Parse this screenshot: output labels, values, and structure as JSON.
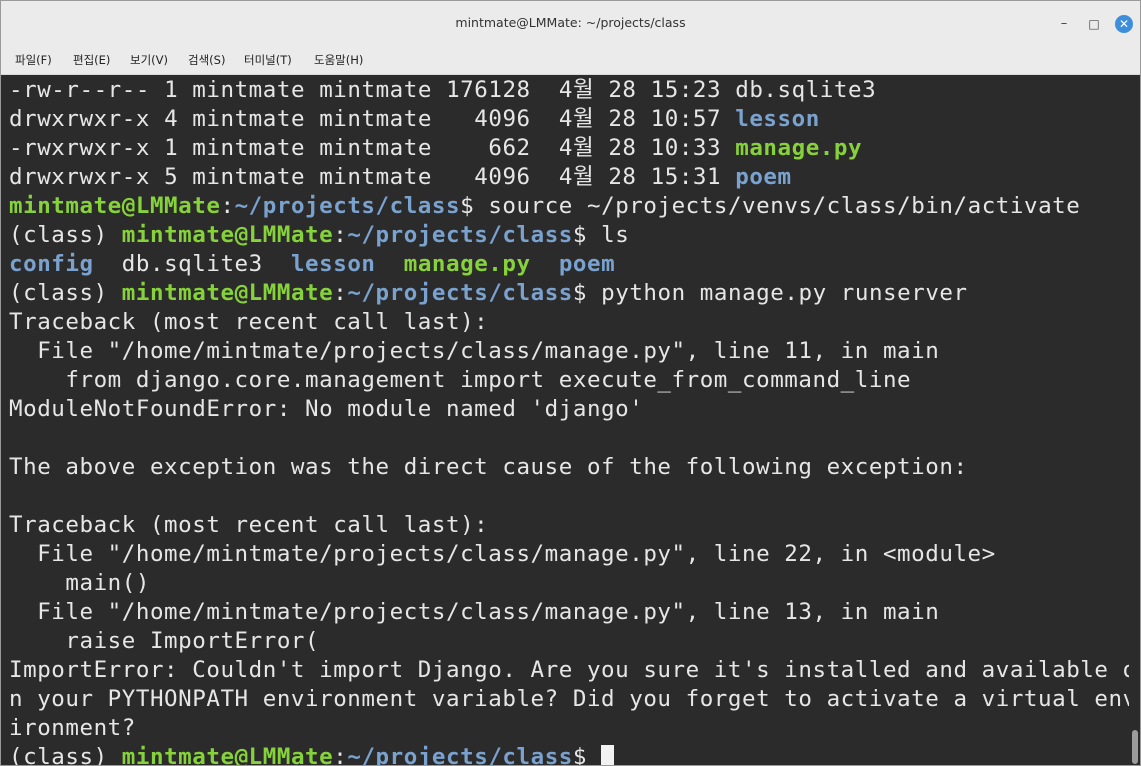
{
  "window": {
    "title": "mintmate@LMMate: ~/projects/class"
  },
  "menu": {
    "items": [
      "파일(F)",
      "편집(E)",
      "보기(V)",
      "검색(S)",
      "터미널(T)",
      "도움말(H)"
    ]
  },
  "colors": {
    "prompt": "#86d23a",
    "directory": "#7aa2cf",
    "text": "#e6e6e6",
    "background": "#2b2b2b"
  },
  "terminal": {
    "ls": [
      {
        "perm": "-rw-r--r--",
        "links": "1",
        "owner": "mintmate",
        "group": "mintmate",
        "size": "176128",
        "month": "4월",
        "day": "28",
        "time": "15:23",
        "name": "db.sqlite3"
      },
      {
        "perm": "drwxrwxr-x",
        "links": "4",
        "owner": "mintmate",
        "group": "mintmate",
        "size": "4096",
        "month": "4월",
        "day": "28",
        "time": "10:57",
        "name": "lesson"
      },
      {
        "perm": "-rwxrwxr-x",
        "links": "1",
        "owner": "mintmate",
        "group": "mintmate",
        "size": "662",
        "month": "4월",
        "day": "28",
        "time": "10:33",
        "name": "manage.py"
      },
      {
        "perm": "drwxrwxr-x",
        "links": "5",
        "owner": "mintmate",
        "group": "mintmate",
        "size": "4096",
        "month": "4월",
        "day": "28",
        "time": "15:31",
        "name": "poem"
      }
    ],
    "prompt_user": "mintmate@LMMate",
    "prompt_colon": ":",
    "prompt_path": "~/projects/class",
    "prompt_dollar": "$",
    "venv": "(class)",
    "cmd1": "source ~/projects/venvs/class/bin/activate",
    "cmd2": "ls",
    "ls_short": [
      "config",
      "db.sqlite3",
      "lesson",
      "manage.py",
      "poem"
    ],
    "cmd3": "python manage.py runserver",
    "output": [
      "Traceback (most recent call last):",
      "  File \"/home/mintmate/projects/class/manage.py\", line 11, in main",
      "    from django.core.management import execute_from_command_line",
      "ModuleNotFoundError: No module named 'django'",
      "",
      "The above exception was the direct cause of the following exception:",
      "",
      "Traceback (most recent call last):",
      "  File \"/home/mintmate/projects/class/manage.py\", line 22, in <module>",
      "    main()",
      "  File \"/home/mintmate/projects/class/manage.py\", line 13, in main",
      "    raise ImportError(",
      "ImportError: Couldn't import Django. Are you sure it's installed and available o",
      "n your PYTHONPATH environment variable? Did you forget to activate a virtual env",
      "ironment?"
    ]
  }
}
